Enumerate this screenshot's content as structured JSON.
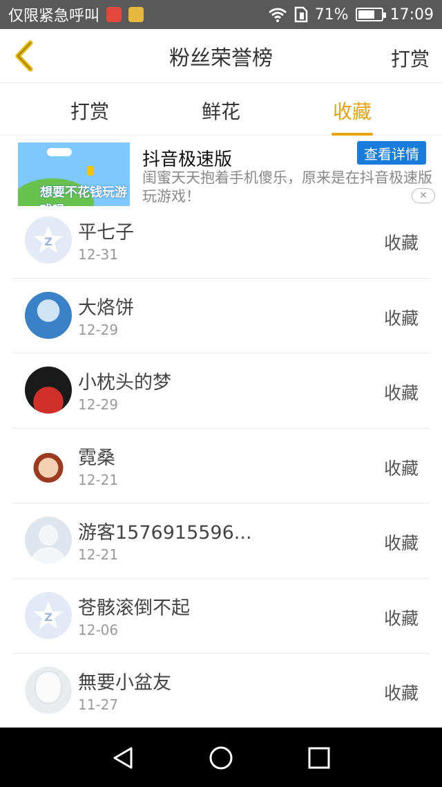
{
  "status_bar": {
    "carrier": "仅限紧急呼叫",
    "battery_percent": "71%",
    "battery_level": 0.71,
    "time": "17:09"
  },
  "header": {
    "title": "粉丝荣誉榜",
    "right_action": "打赏"
  },
  "tabs": [
    {
      "label": "打赏",
      "active": false
    },
    {
      "label": "鲜花",
      "active": false
    },
    {
      "label": "收藏",
      "active": true
    }
  ],
  "ad": {
    "title": "抖音极速版",
    "button": "查看详情",
    "description": "闺蜜天天抱着手机傻乐，原来是在抖音极速版玩游戏！",
    "thumb_text": "想要不花钱玩游戏吗"
  },
  "list": [
    {
      "name": "平七子",
      "date": "12-31",
      "action": "收藏"
    },
    {
      "name": "大烙饼",
      "date": "12-29",
      "action": "收藏"
    },
    {
      "name": "小枕头的梦",
      "date": "12-29",
      "action": "收藏"
    },
    {
      "name": "霓桑",
      "date": "12-21",
      "action": "收藏"
    },
    {
      "name": "游客1576915596...",
      "date": "12-21",
      "action": "收藏"
    },
    {
      "name": "苍骸滚倒不起",
      "date": "12-06",
      "action": "收藏"
    },
    {
      "name": "無要小盆友",
      "date": "11-27",
      "action": "收藏"
    }
  ],
  "colors": {
    "accent": "#e6a20f",
    "status_bar": "#595959",
    "ad_button": "#1a7ddb"
  }
}
